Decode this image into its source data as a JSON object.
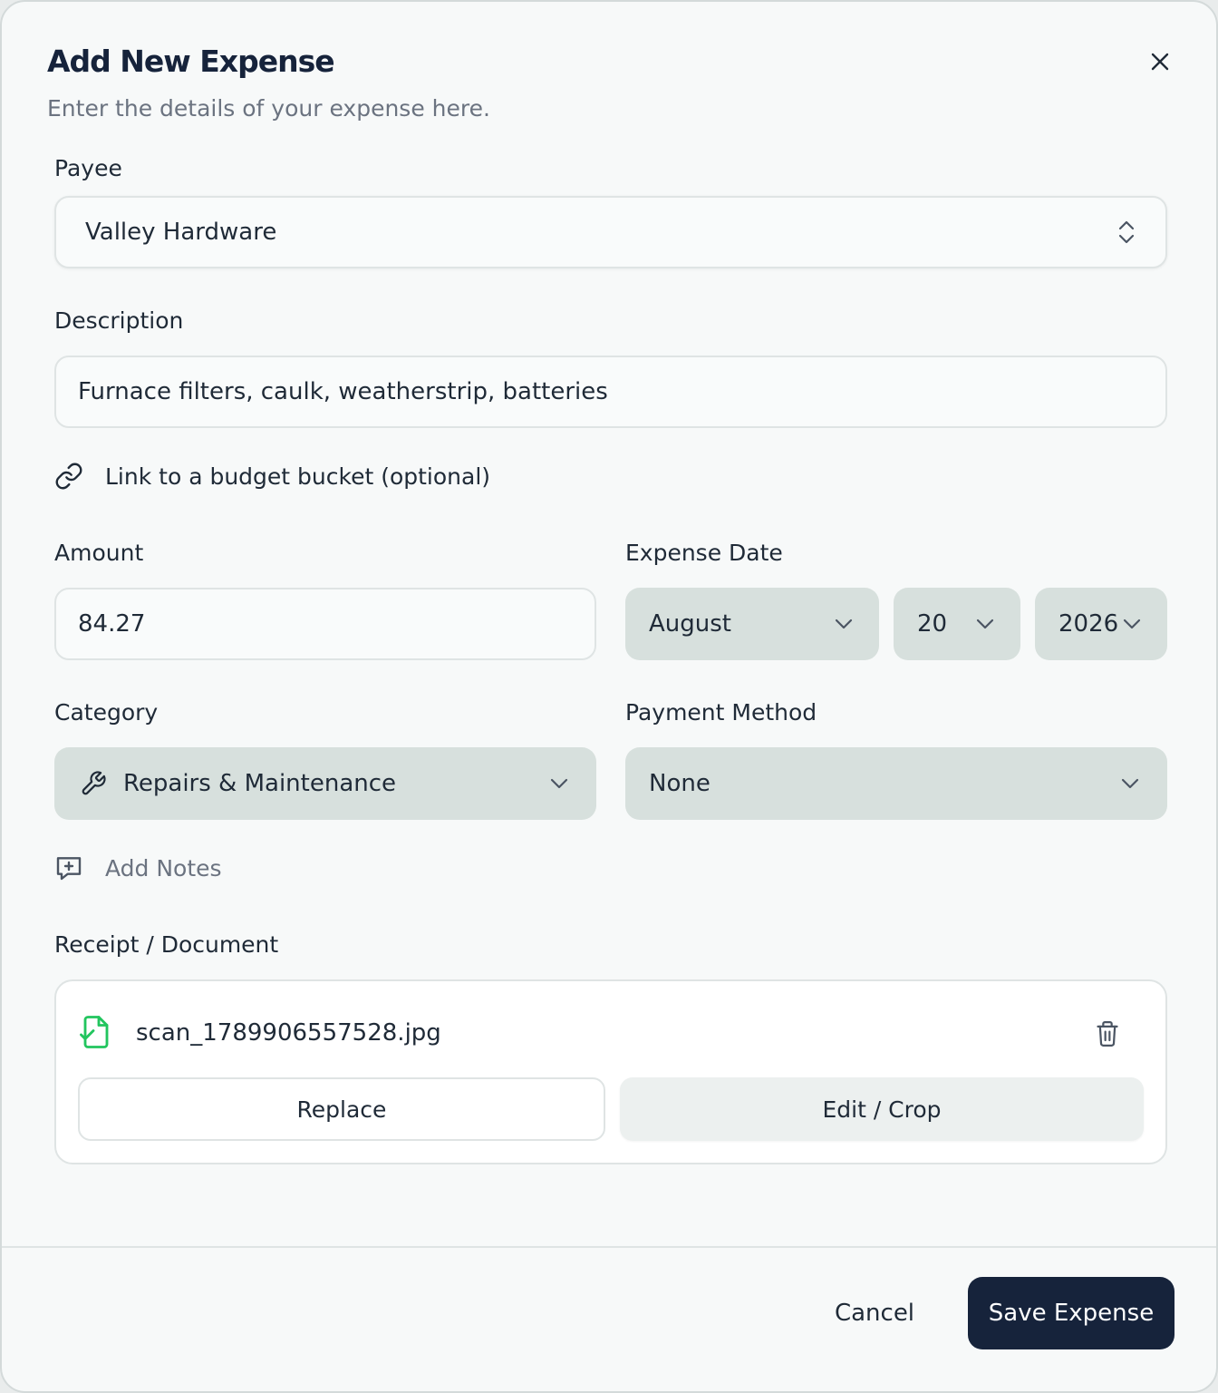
{
  "dialog": {
    "title": "Add New Expense",
    "subtitle": "Enter the details of your expense here.",
    "close_icon": "close-icon"
  },
  "payee": {
    "label": "Payee",
    "value": "Valley Hardware",
    "icon": "chevron-up-down-icon"
  },
  "description": {
    "label": "Description",
    "value": "Furnace filters, caulk, weatherstrip, batteries"
  },
  "budget_link": {
    "label": "Link to a budget bucket (optional)",
    "icon": "link-icon"
  },
  "amount": {
    "label": "Amount",
    "value": "84.27"
  },
  "expense_date": {
    "label": "Expense Date",
    "month": "August",
    "day": "20",
    "year": "2026"
  },
  "category": {
    "label": "Category",
    "value": "Repairs & Maintenance",
    "icon": "wrench-icon"
  },
  "payment_method": {
    "label": "Payment Method",
    "value": "None"
  },
  "notes": {
    "label": "Add Notes",
    "icon": "message-plus-icon"
  },
  "receipt": {
    "label": "Receipt / Document",
    "file_name": "scan_1789906557528.jpg",
    "file_icon": "file-check-icon",
    "delete_icon": "trash-icon",
    "replace_label": "Replace",
    "edit_label": "Edit / Crop"
  },
  "footer": {
    "cancel_label": "Cancel",
    "save_label": "Save Expense"
  },
  "colors": {
    "primary": "#16233b",
    "select_bg": "#d7e0dd",
    "success": "#22c55e",
    "muted_text": "#6b7380"
  }
}
